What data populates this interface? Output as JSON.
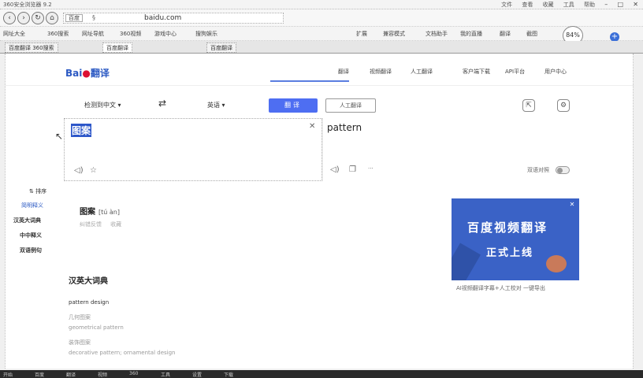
{
  "browser": {
    "title": "360安全浏览器 9.2",
    "menus": [
      "文件",
      "查看",
      "收藏",
      "工具",
      "帮助"
    ],
    "address_tag": "百度",
    "address_url": "baidu.com",
    "zoom_badge": "84",
    "tabs": [
      "百度翻译 360搜索",
      "百度翻译",
      "百度翻译"
    ],
    "bookmarks": [
      "网址大全",
      "360搜索",
      "网址导航",
      "360视频",
      "游戏中心",
      "搜狗娱乐",
      "扩展",
      "兼容模式",
      "文档助手",
      "我的直播",
      "翻译",
      "截图"
    ]
  },
  "site": {
    "logo_text": "Bai",
    "logo_suffix": "翻译",
    "nav": [
      "翻译",
      "视频翻译",
      "人工翻译",
      "客户端下载",
      "API平台",
      "用户中心"
    ]
  },
  "langbar": {
    "source_lang": "检测到中文",
    "target_lang": "英语",
    "translate_label": "翻译",
    "human_label": "人工翻译"
  },
  "source": {
    "text": "图案"
  },
  "result": {
    "text": "pattern"
  },
  "sidebar": {
    "items": [
      {
        "label": "排序"
      },
      {
        "label": "简明释义"
      },
      {
        "label": "汉英大词典"
      },
      {
        "label": "中中释义"
      },
      {
        "label": "双语例句"
      }
    ]
  },
  "entry": {
    "word": "图案",
    "pinyin": "[tú àn]",
    "meta": [
      "纠错反馈",
      "收藏"
    ]
  },
  "dictionary": {
    "title": "汉英大词典",
    "headline": "pattern design",
    "lines": [
      "几何图案",
      "geometrical pattern",
      "装饰图案",
      "decorative pattern; ornamental design"
    ]
  },
  "ad": {
    "line1": "百度视频翻译",
    "line2": "正式上线",
    "caption": "AI视频翻译字幕+人工校对 一键导出"
  },
  "result_toggle_label": "双语对照",
  "taskbar": [
    "开始",
    "百度",
    "翻译",
    "视频",
    "360",
    "工具",
    "设置",
    "下载"
  ],
  "colors": {
    "accent": "#4e6ef2",
    "ad_bg": "#3a62c6",
    "selection": "#2d57c9"
  }
}
